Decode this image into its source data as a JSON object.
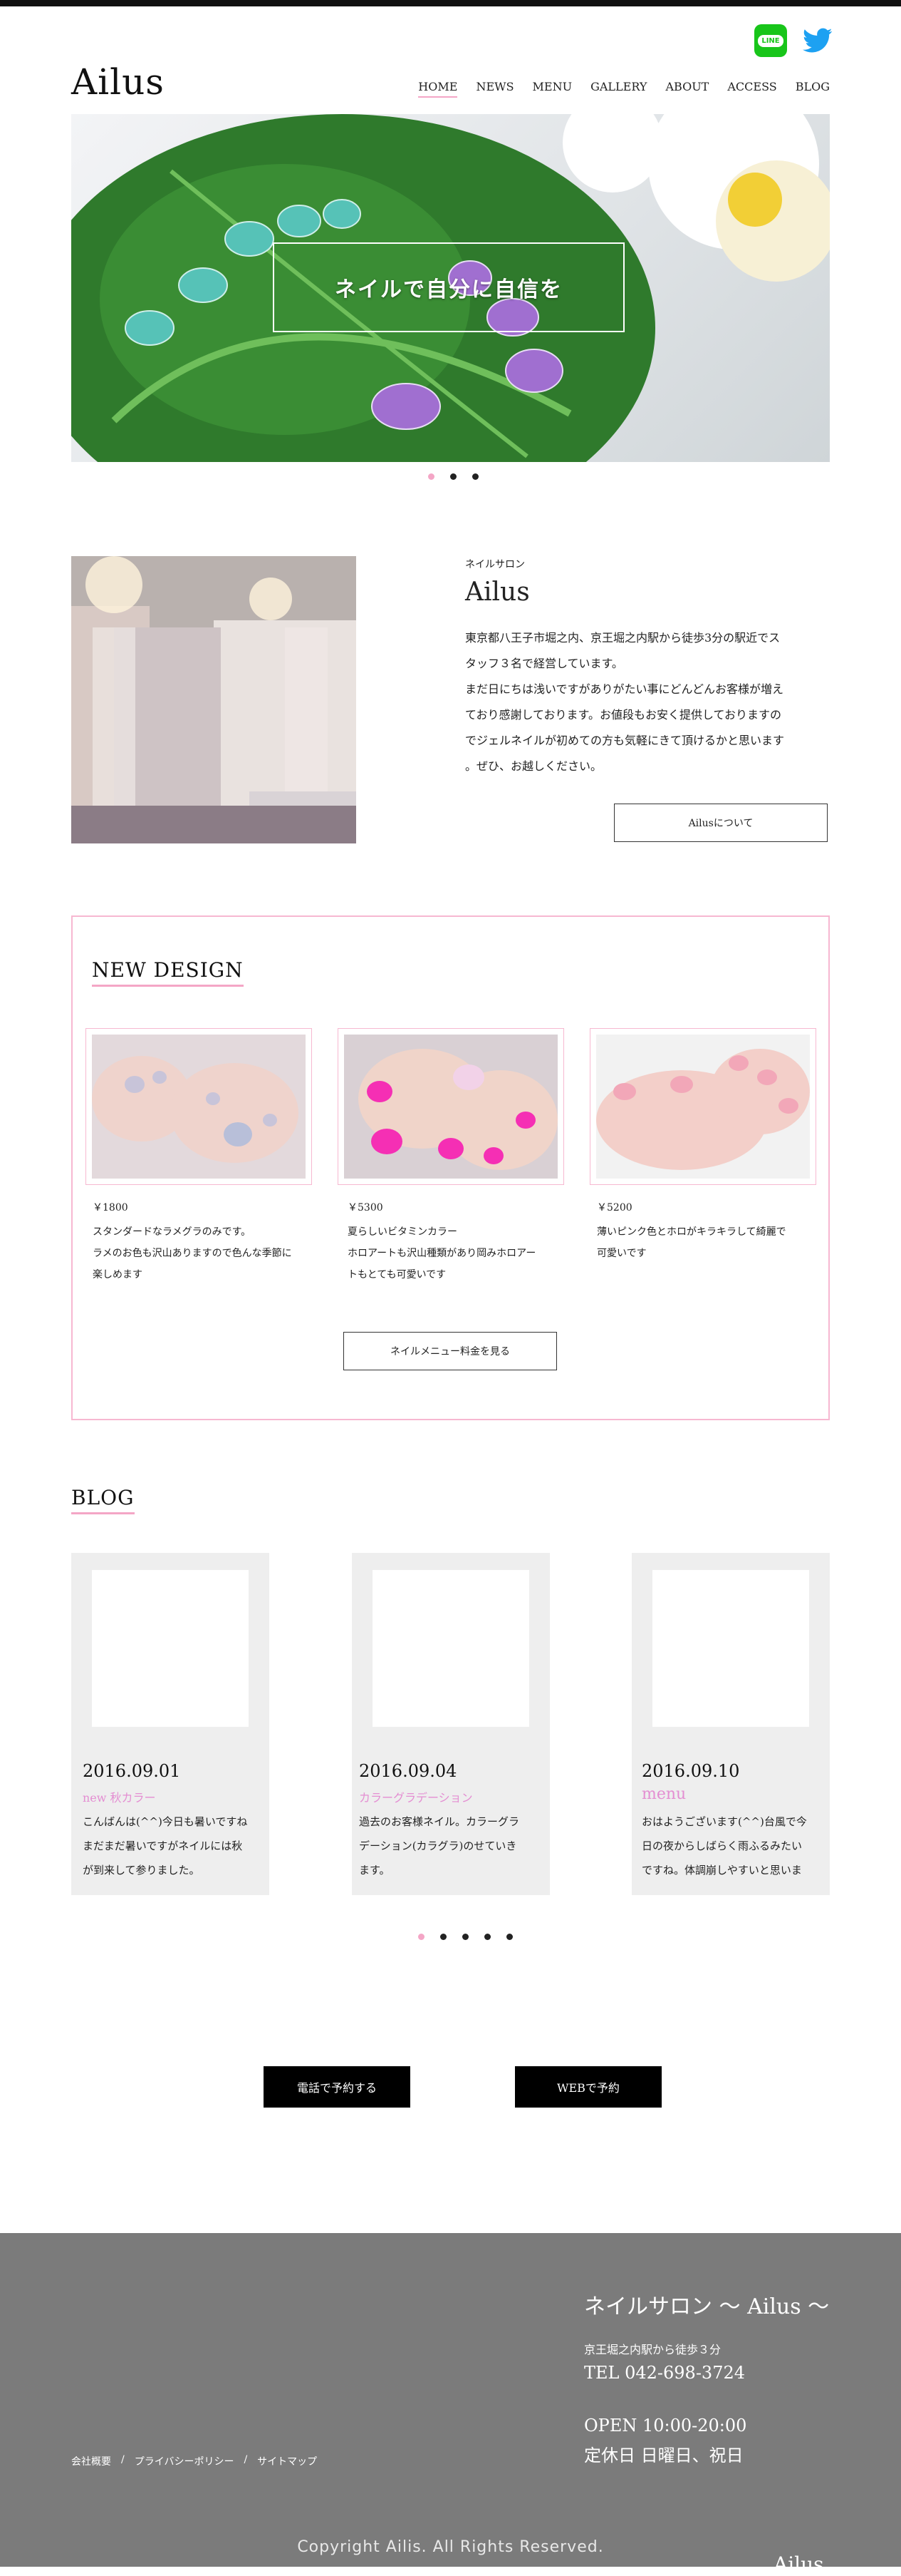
{
  "brand": {
    "logo": "Ailus"
  },
  "social": {
    "line": "LINE",
    "twitter_icon": "twitter-bird-icon"
  },
  "nav": {
    "items": [
      "HOME",
      "NEWS",
      "MENU",
      "GALLERY",
      "ABOUT",
      "ACCESS",
      "BLOG"
    ],
    "active": "HOME"
  },
  "hero": {
    "caption": "ネイルで自分に自信を",
    "slide_count": 3,
    "current_slide": 1
  },
  "about": {
    "kicker": "ネイルサロン",
    "title": "Ailus",
    "body": [
      "東京都八王子市堀之内、京王堀之内駅から徒歩3分の駅近でス",
      "タッフ３名で経営しています。",
      "まだ日にちは浅いですがありがたい事にどんどんお客様が増え",
      "ており感謝しております。お値段もお安く提供しておりますの",
      "でジェルネイルが初めての方も気軽にきて頂けるかと思います",
      "。ぜひ、お越しください。"
    ],
    "button": "Ailusについて"
  },
  "new_design": {
    "title": "NEW DESIGN",
    "cards": [
      {
        "price": "￥1800",
        "text": [
          "スタンダードなラメグラのみです。",
          "ラメのお色も沢山ありますので色んな季節に",
          "楽しめます"
        ]
      },
      {
        "price": "￥5300",
        "text": [
          "夏らしいビタミンカラー",
          "ホロアートも沢山種類があり岡みホロアー",
          "トもとても可愛いです"
        ]
      },
      {
        "price": "￥5200",
        "text": [
          "薄いピンク色とホロがキラキラして綺麗で",
          "可愛いです"
        ]
      }
    ],
    "button": "ネイルメニュー料金を見る"
  },
  "blog": {
    "title": "BLOG",
    "posts": [
      {
        "date": "2016.09.01",
        "category": "new 秋カラー",
        "text": [
          "こんばんは(^^)今日も暑いですね",
          "まだまだ暑いですがネイルには秋",
          "が到来して参りました。"
        ]
      },
      {
        "date": "2016.09.04",
        "category": "カラーグラデーション",
        "text": [
          "過去のお客様ネイル。カラーグラ",
          "デーション(カラグラ)のせていき",
          "ます。"
        ]
      },
      {
        "date": "2016.09.10",
        "category": "menu",
        "text": [
          "おはようございます(^^)台風で今",
          "日の夜からしばらく雨ふるみたい",
          "ですね。体調崩しやすいと思いま"
        ]
      }
    ],
    "slide_count": 5,
    "current_slide": 1
  },
  "reserve": {
    "phone": "電話で予約する",
    "web": "WEBで予約"
  },
  "footer": {
    "name": "ネイルサロン 〜 Ailus 〜",
    "access": "京王堀之内駅から徒歩３分",
    "tel": "TEL 042-698-3724",
    "open": "OPEN 10:00-20:00",
    "closed": "定休日 日曜日、祝日",
    "links": [
      "会社概要",
      "プライバシーポリシー",
      "サイトマップ"
    ],
    "copyright": "Copyright Ailis. All Rights Reserved.",
    "logo_peek": "Ailus"
  },
  "colors": {
    "accent_pink": "#f4a6c6",
    "footer_gray": "#7b7b7b",
    "line_green": "#18c51a",
    "twitter_blue": "#1da1f2"
  }
}
